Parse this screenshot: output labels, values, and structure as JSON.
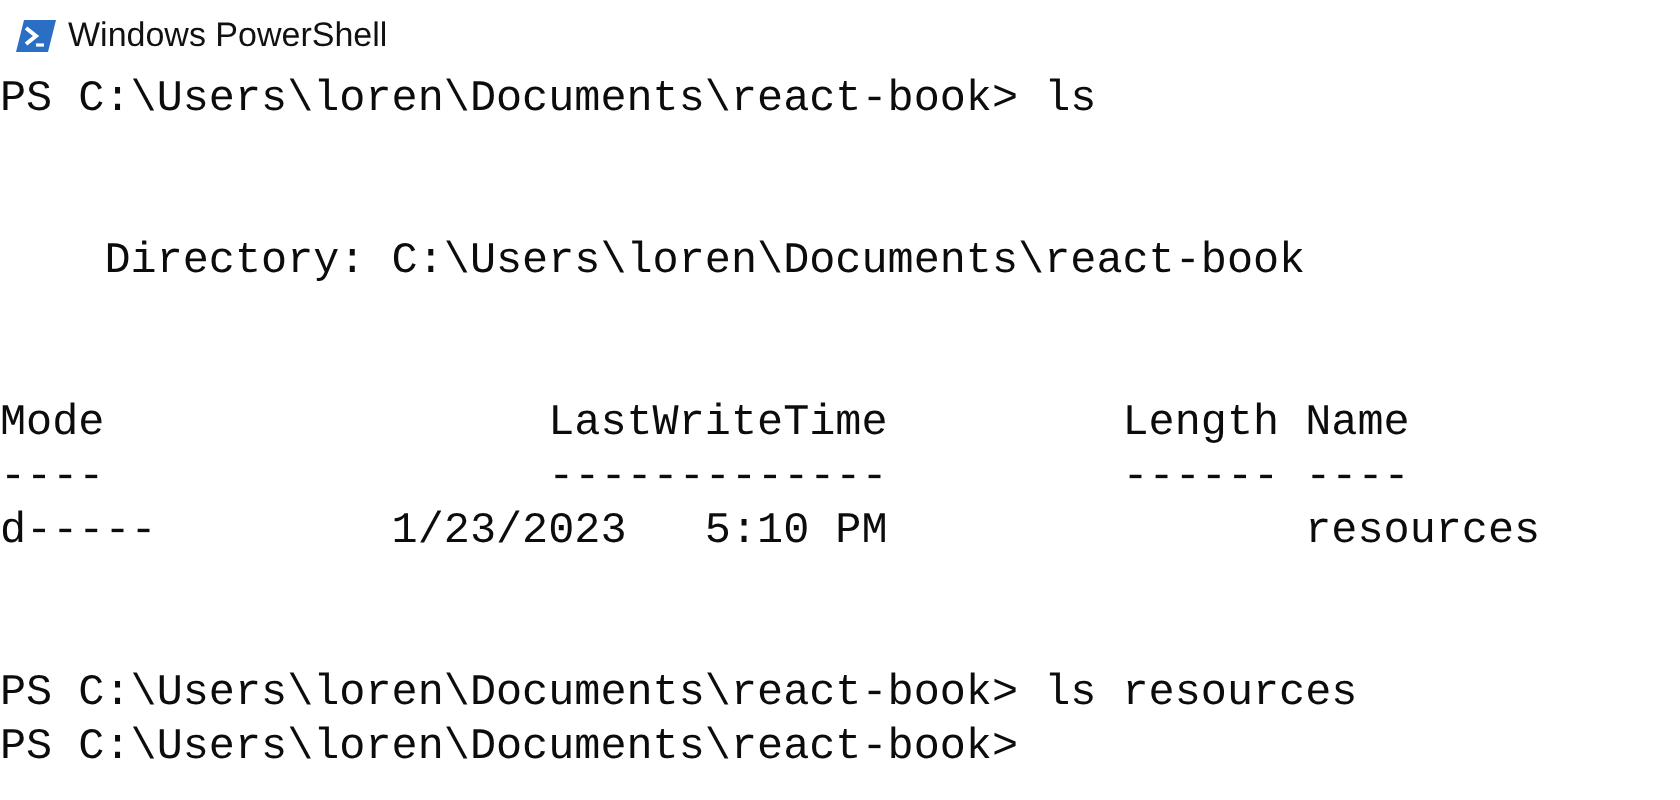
{
  "window": {
    "title": "Windows PowerShell"
  },
  "console": {
    "blocks": [
      {
        "lines": [
          "PS C:\\Users\\loren\\Documents\\react-book> ls"
        ]
      },
      {
        "lines": [
          "    Directory: C:\\Users\\loren\\Documents\\react-book"
        ]
      },
      {
        "lines": [
          "Mode                 LastWriteTime         Length Name",
          "----                 -------------         ------ ----",
          "d-----         1/23/2023   5:10 PM                resources"
        ]
      },
      {
        "lines": [
          "PS C:\\Users\\loren\\Documents\\react-book> ls resources",
          "PS C:\\Users\\loren\\Documents\\react-book>"
        ]
      }
    ]
  }
}
